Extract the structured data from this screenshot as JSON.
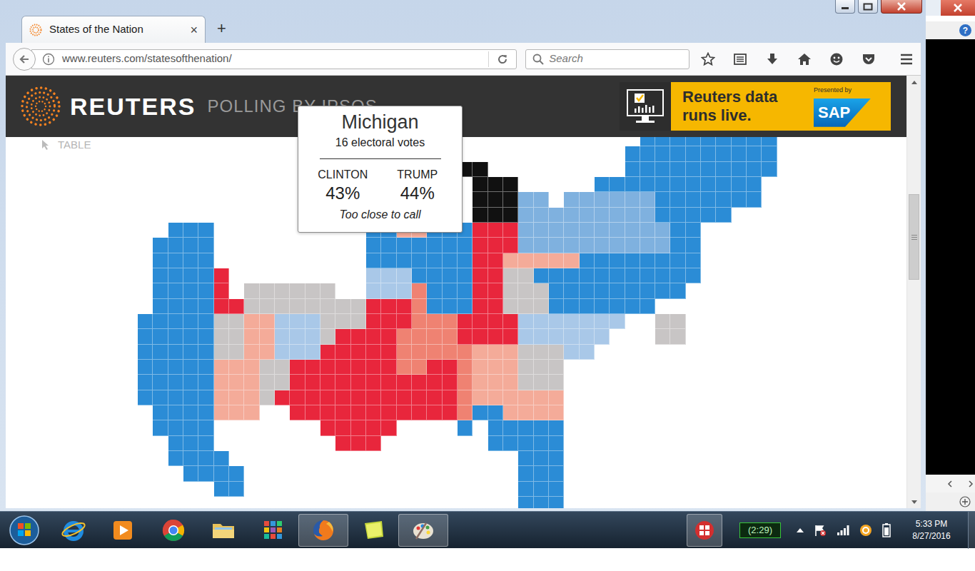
{
  "tabs": [
    {
      "label": "States of the Nation",
      "selected": true,
      "close": "×"
    }
  ],
  "new_tab": "+",
  "toolbar": {
    "url": "www.reuters.com/statesofthenation/",
    "search_placeholder": "Search"
  },
  "page": {
    "brand": "REUTERS",
    "subtitle": "POLLING BY IPSOS",
    "table_link": "TABLE",
    "ad": {
      "lines": [
        "Reuters data",
        "runs live."
      ],
      "presented_by": "Presented by",
      "sponsor": "SAP"
    }
  },
  "map": {
    "categories": [
      {
        "color": "#2b8cd6"
      },
      {
        "color": "#7fb1df"
      },
      {
        "color": "#a9c8e8"
      },
      {
        "color": "#e8263c"
      },
      {
        "color": "#ef8272"
      },
      {
        "color": "#f4ab99"
      },
      {
        "color": "#c8c5c5"
      },
      {
        "color": "#111111"
      }
    ],
    "rows": [
      [
        [
          0,
          33
        ],
        [
          1,
          9
        ]
      ],
      [
        [
          0,
          32
        ],
        [
          1,
          10
        ]
      ],
      [
        [
          0,
          21
        ],
        [
          8,
          2
        ],
        [
          0,
          9
        ],
        [
          1,
          10
        ]
      ],
      [
        [
          0,
          22
        ],
        [
          8,
          3
        ],
        [
          0,
          5
        ],
        [
          1,
          11
        ],
        [
          0,
          1
        ]
      ],
      [
        [
          0,
          22
        ],
        [
          8,
          3
        ],
        [
          2,
          2
        ],
        [
          0,
          1
        ],
        [
          2,
          6
        ],
        [
          1,
          7
        ],
        [
          0,
          1
        ]
      ],
      [
        [
          0,
          22
        ],
        [
          8,
          3
        ],
        [
          2,
          9
        ],
        [
          1,
          5
        ],
        [
          0,
          3
        ]
      ],
      [
        [
          0,
          2
        ],
        [
          1,
          3
        ],
        [
          0,
          10
        ],
        [
          1,
          2
        ],
        [
          6,
          2
        ],
        [
          1,
          3
        ],
        [
          4,
          3
        ],
        [
          2,
          10
        ],
        [
          1,
          2
        ],
        [
          0,
          5
        ]
      ],
      [
        [
          0,
          1
        ],
        [
          1,
          4
        ],
        [
          0,
          10
        ],
        [
          1,
          7
        ],
        [
          4,
          3
        ],
        [
          2,
          10
        ],
        [
          1,
          2
        ],
        [
          0,
          5
        ]
      ],
      [
        [
          0,
          1
        ],
        [
          1,
          4
        ],
        [
          0,
          10
        ],
        [
          1,
          7
        ],
        [
          4,
          2
        ],
        [
          6,
          5
        ],
        [
          1,
          8
        ],
        [
          0,
          5
        ]
      ],
      [
        [
          0,
          1
        ],
        [
          1,
          4
        ],
        [
          4,
          1
        ],
        [
          0,
          9
        ],
        [
          3,
          3
        ],
        [
          1,
          4
        ],
        [
          4,
          2
        ],
        [
          7,
          2
        ],
        [
          1,
          11
        ],
        [
          0,
          5
        ]
      ],
      [
        [
          0,
          1
        ],
        [
          1,
          4
        ],
        [
          4,
          1
        ],
        [
          0,
          1
        ],
        [
          7,
          6
        ],
        [
          0,
          2
        ],
        [
          3,
          3
        ],
        [
          5,
          1
        ],
        [
          1,
          3
        ],
        [
          4,
          2
        ],
        [
          7,
          3
        ],
        [
          1,
          9
        ],
        [
          0,
          6
        ]
      ],
      [
        [
          0,
          1
        ],
        [
          1,
          4
        ],
        [
          4,
          2
        ],
        [
          7,
          8
        ],
        [
          4,
          3
        ],
        [
          5,
          1
        ],
        [
          1,
          3
        ],
        [
          4,
          2
        ],
        [
          7,
          3
        ],
        [
          1,
          7
        ],
        [
          0,
          8
        ]
      ],
      [
        [
          1,
          5
        ],
        [
          7,
          2
        ],
        [
          6,
          2
        ],
        [
          3,
          3
        ],
        [
          7,
          3
        ],
        [
          4,
          3
        ],
        [
          5,
          3
        ],
        [
          4,
          4
        ],
        [
          3,
          7
        ],
        [
          0,
          2
        ],
        [
          7,
          2
        ],
        [
          0,
          6
        ]
      ],
      [
        [
          1,
          5
        ],
        [
          7,
          2
        ],
        [
          6,
          2
        ],
        [
          3,
          3
        ],
        [
          7,
          1
        ],
        [
          4,
          4
        ],
        [
          5,
          4
        ],
        [
          4,
          4
        ],
        [
          3,
          6
        ],
        [
          0,
          3
        ],
        [
          7,
          2
        ],
        [
          0,
          6
        ]
      ],
      [
        [
          1,
          5
        ],
        [
          7,
          2
        ],
        [
          6,
          2
        ],
        [
          3,
          3
        ],
        [
          4,
          5
        ],
        [
          5,
          5
        ],
        [
          6,
          3
        ],
        [
          7,
          3
        ],
        [
          3,
          2
        ],
        [
          0,
          12
        ]
      ],
      [
        [
          1,
          5
        ],
        [
          6,
          3
        ],
        [
          7,
          2
        ],
        [
          4,
          7
        ],
        [
          5,
          2
        ],
        [
          4,
          2
        ],
        [
          5,
          1
        ],
        [
          6,
          3
        ],
        [
          7,
          3
        ],
        [
          0,
          14
        ]
      ],
      [
        [
          1,
          5
        ],
        [
          6,
          3
        ],
        [
          7,
          2
        ],
        [
          4,
          11
        ],
        [
          5,
          1
        ],
        [
          6,
          3
        ],
        [
          7,
          3
        ],
        [
          0,
          14
        ]
      ],
      [
        [
          1,
          5
        ],
        [
          6,
          3
        ],
        [
          7,
          1
        ],
        [
          4,
          12
        ],
        [
          5,
          1
        ],
        [
          6,
          6
        ],
        [
          0,
          14
        ]
      ],
      [
        [
          0,
          1
        ],
        [
          1,
          4
        ],
        [
          6,
          3
        ],
        [
          0,
          2
        ],
        [
          4,
          11
        ],
        [
          5,
          1
        ],
        [
          1,
          2
        ],
        [
          6,
          4
        ],
        [
          0,
          14
        ]
      ],
      [
        [
          0,
          1
        ],
        [
          1,
          4
        ],
        [
          0,
          7
        ],
        [
          4,
          5
        ],
        [
          0,
          4
        ],
        [
          1,
          1
        ],
        [
          0,
          1
        ],
        [
          1,
          5
        ],
        [
          0,
          14
        ]
      ],
      [
        [
          0,
          2
        ],
        [
          1,
          3
        ],
        [
          0,
          8
        ],
        [
          4,
          3
        ],
        [
          0,
          7
        ],
        [
          1,
          5
        ],
        [
          0,
          14
        ]
      ],
      [
        [
          0,
          2
        ],
        [
          1,
          4
        ],
        [
          0,
          19
        ],
        [
          1,
          3
        ],
        [
          0,
          14
        ]
      ],
      [
        [
          0,
          3
        ],
        [
          1,
          4
        ],
        [
          0,
          18
        ],
        [
          1,
          3
        ],
        [
          0,
          14
        ]
      ],
      [
        [
          0,
          5
        ],
        [
          1,
          2
        ],
        [
          0,
          18
        ],
        [
          1,
          3
        ],
        [
          0,
          14
        ]
      ],
      [
        [
          0,
          25
        ],
        [
          1,
          3
        ],
        [
          0,
          14
        ]
      ]
    ]
  },
  "tooltip": {
    "state": "Michigan",
    "electoral_votes": "16 electoral votes",
    "candidates": [
      {
        "name": "CLINTON",
        "share": "43%"
      },
      {
        "name": "TRUMP",
        "share": "44%"
      }
    ],
    "verdict": "Too close to call"
  },
  "side_window": {
    "help": "?"
  },
  "taskbar": {
    "apps": [
      {
        "active": false
      },
      {
        "active": false
      },
      {
        "active": false
      },
      {
        "active": false
      },
      {
        "active": false
      },
      {
        "active": false
      },
      {
        "active": true
      },
      {
        "active": false
      },
      {
        "active": true
      }
    ],
    "tray_app": {
      "active": true
    },
    "battery": "(2:29)",
    "time": "5:33 PM",
    "date": "8/27/2016"
  }
}
